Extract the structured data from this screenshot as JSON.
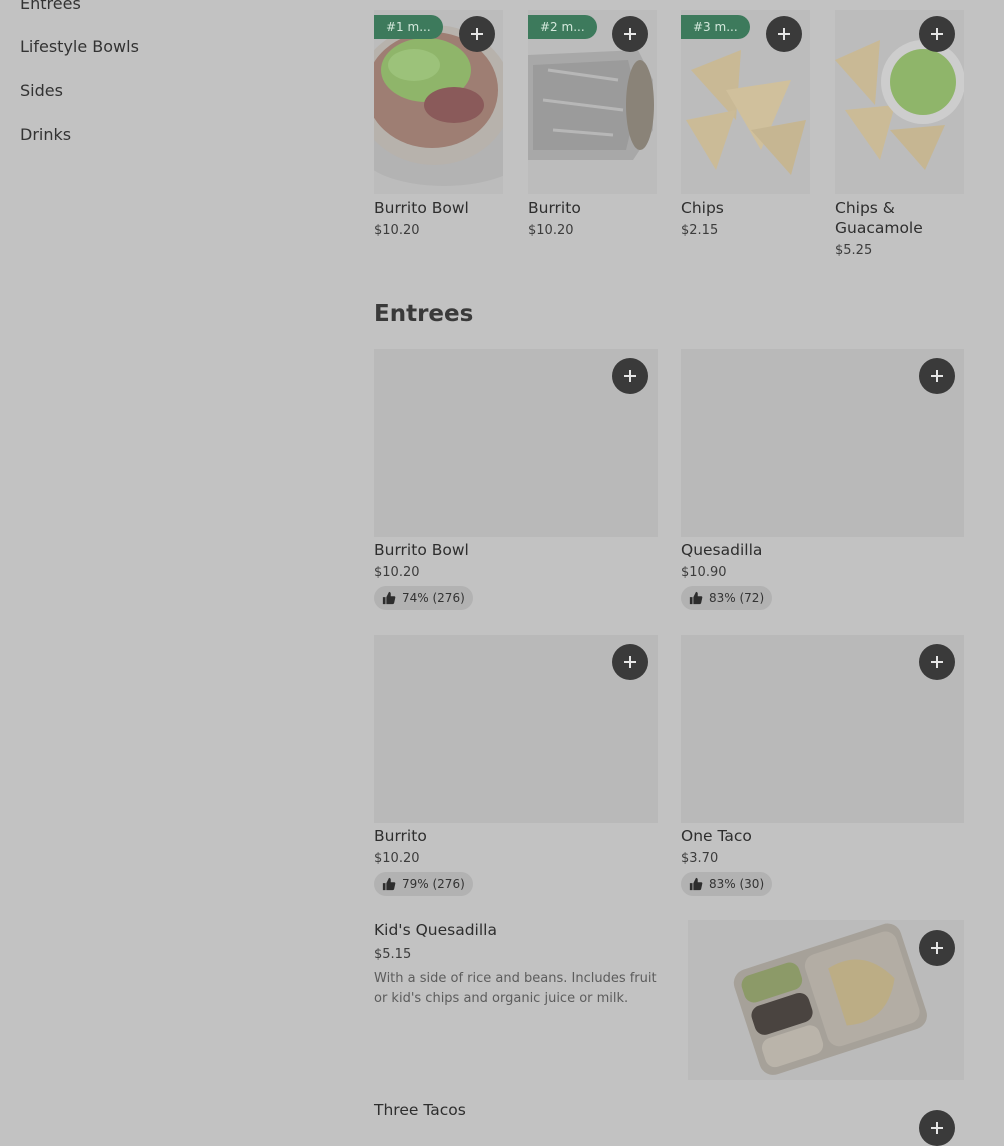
{
  "sidebar": {
    "items": [
      "Entrees",
      "Lifestyle Bowls",
      "Sides",
      "Drinks"
    ]
  },
  "featured": [
    {
      "rank": "#1 m...",
      "name": "Burrito Bowl",
      "price": "$10.20"
    },
    {
      "rank": "#2 m...",
      "name": "Burrito",
      "price": "$10.20"
    },
    {
      "rank": "#3 m...",
      "name": "Chips",
      "price": "$2.15"
    },
    {
      "rank": "",
      "name": "Chips & Guacamole",
      "price": "$5.25"
    }
  ],
  "entrees_title": "Entrees",
  "entrees": [
    {
      "name": "Burrito Bowl",
      "price": "$10.20",
      "rating": "74% (276)"
    },
    {
      "name": "Quesadilla",
      "price": "$10.90",
      "rating": "83% (72)"
    },
    {
      "name": "Burrito",
      "price": "$10.20",
      "rating": "79% (276)"
    },
    {
      "name": "One Taco",
      "price": "$3.70",
      "rating": "83% (30)"
    }
  ],
  "kids": {
    "name": "Kid's Quesadilla",
    "price": "$5.15",
    "description": "With a side of rice and beans. Includes fruit or kid's chips and organic juice or milk."
  },
  "next_item": {
    "name": "Three Tacos"
  }
}
